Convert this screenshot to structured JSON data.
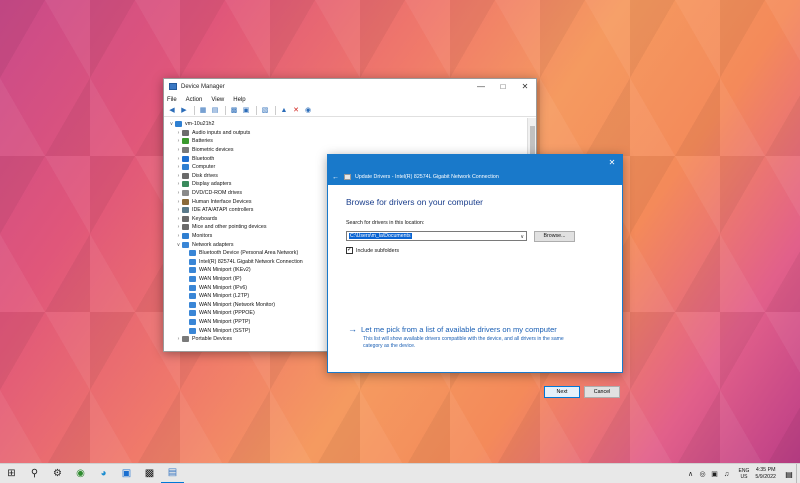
{
  "device_manager": {
    "title": "Device Manager",
    "menu": [
      "File",
      "Action",
      "View",
      "Help"
    ],
    "tree_root": "vm-10u21h2",
    "categories": [
      {
        "label": "Audio inputs and outputs",
        "color": "#6d6d6d",
        "expanded": false
      },
      {
        "label": "Batteries",
        "color": "#3b9a2e",
        "expanded": false
      },
      {
        "label": "Biometric devices",
        "color": "#7a7a7a",
        "expanded": false
      },
      {
        "label": "Bluetooth",
        "color": "#1e6fd0",
        "expanded": false
      },
      {
        "label": "Computer",
        "color": "#2f7fd1",
        "expanded": false
      },
      {
        "label": "Disk drives",
        "color": "#6a6a6a",
        "expanded": false
      },
      {
        "label": "Display adapters",
        "color": "#3a8a5c",
        "expanded": false
      },
      {
        "label": "DVD/CD-ROM drives",
        "color": "#8a8a8a",
        "expanded": false
      },
      {
        "label": "Human Interface Devices",
        "color": "#8a6a3a",
        "expanded": false
      },
      {
        "label": "IDE ATA/ATAPI controllers",
        "color": "#5a7a8a",
        "expanded": false
      },
      {
        "label": "Keyboards",
        "color": "#6a6a6a",
        "expanded": false
      },
      {
        "label": "Mice and other pointing devices",
        "color": "#6a6a6a",
        "expanded": false
      },
      {
        "label": "Monitors",
        "color": "#2f7fd1",
        "expanded": false
      },
      {
        "label": "Network adapters",
        "color": "#3a86d6",
        "expanded": true
      }
    ],
    "network_adapters": [
      "Bluetooth Device (Personal Area Network)",
      "Intel(R) 82574L Gigabit Network Connection",
      "WAN Miniport (IKEv2)",
      "WAN Miniport (IP)",
      "WAN Miniport (IPv6)",
      "WAN Miniport (L2TP)",
      "WAN Miniport (Network Monitor)",
      "WAN Miniport (PPPOE)",
      "WAN Miniport (PPTP)",
      "WAN Miniport (SSTP)"
    ],
    "partial_item": "Portable Devices"
  },
  "update_drivers": {
    "header_title": "Update Drivers - Intel(R) 82574L Gigabit Network Connection",
    "heading": "Browse for drivers on your computer",
    "search_label": "Search for drivers in this location:",
    "path_value": "C:\\Users\\m_la\\Documents",
    "browse_label": "Browse...",
    "include_subfolders_label": "Include subfolders",
    "include_subfolders_checked": true,
    "pick_title": "Let me pick from a list of available drivers on my computer",
    "pick_description": "This list will show available drivers compatible with the device, and all drivers in the same category as the device.",
    "next_label": "Next",
    "cancel_label": "Cancel"
  },
  "taskbar": {
    "lang_top": "ENG",
    "lang_bottom": "US",
    "time": "4:35 PM",
    "date": "5/9/2022"
  }
}
